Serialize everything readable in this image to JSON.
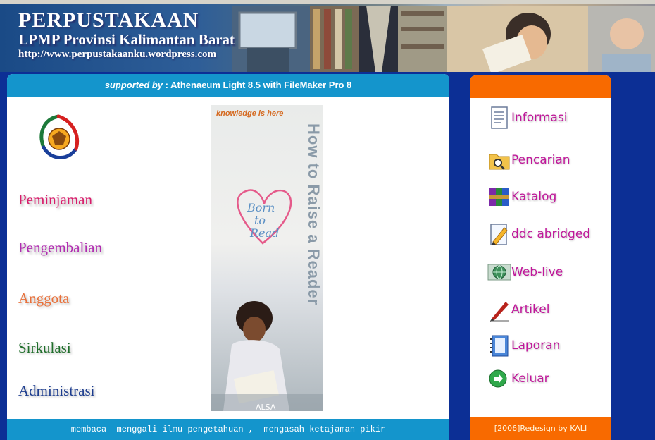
{
  "header": {
    "title": "PERPUSTAKAAN",
    "subtitle": "LPMP Provinsi Kalimantan Barat",
    "url": "http://www.perpustakaanku.wordpress.com"
  },
  "main": {
    "supported_prefix": "supported by",
    "supported_text": " : Athenaeum Light 8.5 with FileMaker Pro 8",
    "footer_text": "membaca  menggali ilmu pengetahuan ,  mengasah ketajaman pikir",
    "menu": [
      {
        "label": "Peminjaman",
        "color": "#d81b6a"
      },
      {
        "label": "Pengembalian",
        "color": "#b02bb0"
      },
      {
        "label": "Anggota",
        "color": "#e8703a"
      },
      {
        "label": "Sirkulasi",
        "color": "#1f6e2a"
      },
      {
        "label": "Administrasi",
        "color": "#1c3c8e"
      }
    ],
    "poster": {
      "tagline": "knowledge is here",
      "vertical_title": "How to Raise a Reader",
      "heart_text": [
        "Born",
        "to",
        "Read"
      ],
      "watermark": "ALSA"
    }
  },
  "sidebar": {
    "items": [
      {
        "label": "Informasi",
        "icon": "document-icon"
      },
      {
        "label": "Pencarian",
        "icon": "search-folder-icon"
      },
      {
        "label": "Katalog",
        "icon": "archive-books-icon"
      },
      {
        "label": "ddc abridged",
        "icon": "edit-document-icon"
      },
      {
        "label": "Web-live",
        "icon": "globe-icon"
      },
      {
        "label": "Artikel",
        "icon": "pen-icon"
      },
      {
        "label": "Laporan",
        "icon": "notebook-icon"
      },
      {
        "label": "Keluar",
        "icon": "exit-arrow-icon"
      }
    ],
    "footer_text": "[2006]Redesign by KALI"
  },
  "colors": {
    "page_background": "#0c2f95",
    "main_bar": "#1495cc",
    "side_bar": "#f86a00",
    "side_link": "#c0179a"
  }
}
